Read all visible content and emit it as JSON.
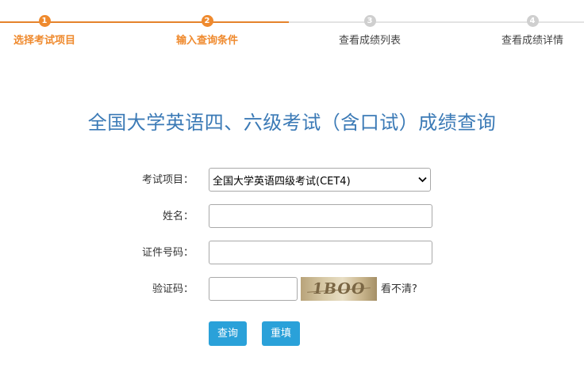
{
  "stepper": {
    "steps": [
      {
        "number": "1",
        "label": "选择考试项目"
      },
      {
        "number": "2",
        "label": "输入查询条件"
      },
      {
        "number": "3",
        "label": "查看成绩列表"
      },
      {
        "number": "4",
        "label": "查看成绩详情"
      }
    ],
    "current_step": 2
  },
  "title": "全国大学英语四、六级考试（含口试）成绩查询",
  "form": {
    "exam_label": "考试项目：",
    "exam_selected": "全国大学英语四级考试(CET4)",
    "name_label": "姓名：",
    "name_value": "",
    "id_label": "证件号码：",
    "id_value": "",
    "captcha_label": "验证码：",
    "captcha_value": "",
    "captcha_image_text": "1BOO",
    "captcha_refresh": "看不清?"
  },
  "buttons": {
    "query": "查询",
    "reset": "重填"
  },
  "colors": {
    "step_active": "#ef8a2e",
    "step_inactive": "#cfcfcf",
    "title": "#3b7ab6",
    "button": "#2aa1d9"
  }
}
